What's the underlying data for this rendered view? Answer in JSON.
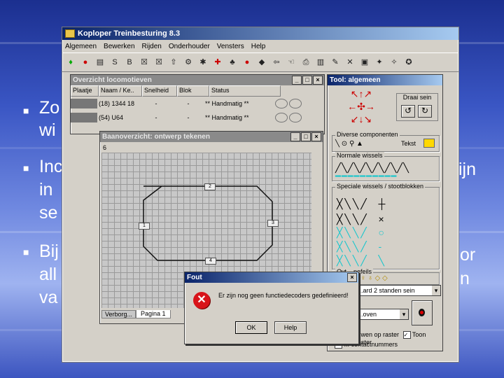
{
  "app": {
    "title": "Koploper Treinbesturing 8.3",
    "menu": [
      "Algemeen",
      "Bewerken",
      "Rijden",
      "Onderhouder",
      "Vensters",
      "Help"
    ]
  },
  "slide": {
    "bullets": [
      {
        "lines": [
          "Zo",
          "wi"
        ]
      },
      {
        "lines": [
          "Inc",
          "in",
          "se"
        ],
        "right_fragments": [
          "ijn"
        ]
      },
      {
        "lines": [
          "Bij",
          "all",
          "va"
        ],
        "right_fragments": [
          "or",
          "n"
        ]
      }
    ]
  },
  "overview": {
    "title": "Overzicht locomotieven",
    "columns": [
      "Plaatje",
      "Naam / Ke..",
      "Snelheid",
      "Blok",
      "Status"
    ],
    "rows": [
      {
        "name": "(18) 1344 18",
        "speed": "-",
        "block": "-",
        "status": "** Handmatig **"
      },
      {
        "name": "(54) U64",
        "speed": "-",
        "block": "-",
        "status": "** Handmatig **"
      }
    ]
  },
  "tools": {
    "title": "Tool: algemeen",
    "rotate_label": "Draai sein",
    "group_components": "Diverse componenten",
    "text_label": "Tekst",
    "group_normal": "Normale wissels",
    "group_special": "Speciale wissels / stootblokken",
    "group_arrows": "Ovt... pefeils",
    "signal_select": "...ard 2 standen sein",
    "direction_select": "...oven",
    "chk_above_grid": "...wen op raster",
    "chk_show_grid": "Toon raster",
    "chk_contact": "... contactnummers"
  },
  "plan": {
    "title": "Baanoverzicht: ontwerp tekenen",
    "page_number": "6",
    "blocks": [
      "2",
      "1",
      "3",
      "4"
    ],
    "tabs": [
      "Verborg...",
      "Pagina 1"
    ]
  },
  "error": {
    "title": "Fout",
    "message": "Er zijn nog geen functiedecoders gedefinieerd!",
    "ok": "OK",
    "help": "Help"
  }
}
